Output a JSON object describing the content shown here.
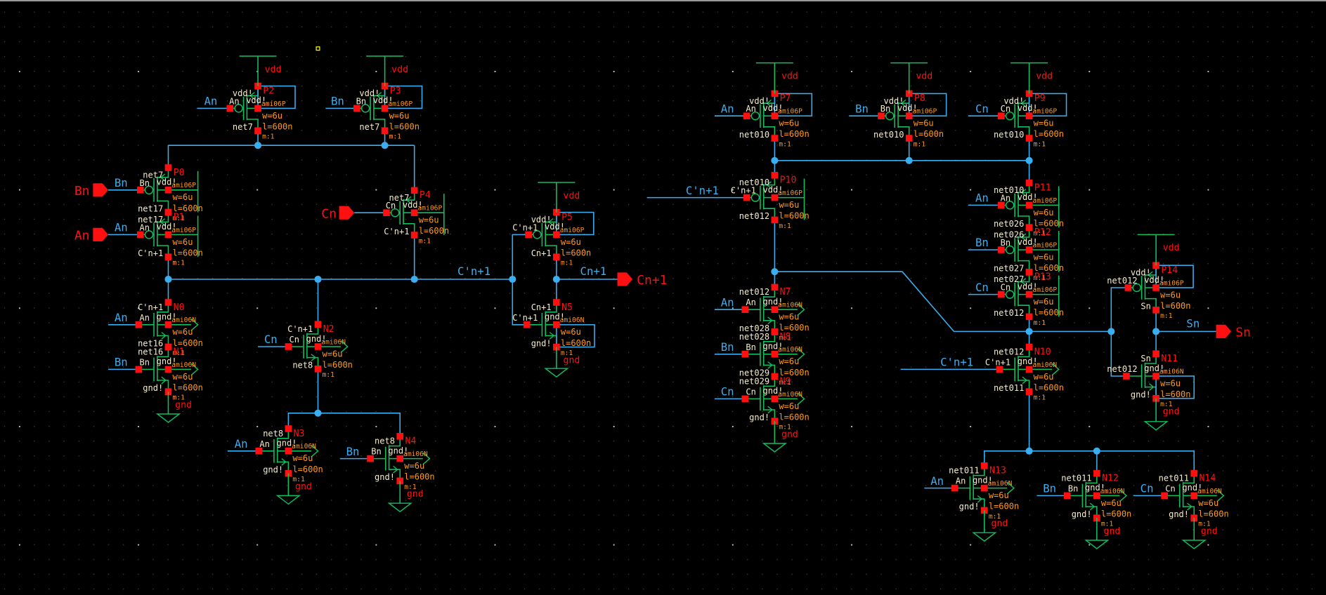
{
  "colors": {
    "background": "#000000",
    "wire": "#3aaef0",
    "device": "#10c060",
    "pin": "#ff1010",
    "net_label": "#f4ecc8",
    "parameter": "#ff9a1a",
    "grid_dot": "#4a4a4a",
    "selection_marker": "#ffff00"
  },
  "supply_labels": {
    "vdd": "vdd",
    "gnd": "gnd"
  },
  "pins": [
    {
      "label": "Bn",
      "direction": "input"
    },
    {
      "label": "An",
      "direction": "input"
    },
    {
      "label": "Cn",
      "direction": "input"
    },
    {
      "label": "Cn+1",
      "direction": "output"
    },
    {
      "label": "Sn",
      "direction": "output"
    }
  ],
  "wire_labels": [
    {
      "text": "C'n+1"
    },
    {
      "text": "Cn+1"
    },
    {
      "text": "Sn"
    }
  ],
  "transistors": [
    {
      "name": "P2",
      "type": "pmos",
      "model": "ami06P",
      "w": "w=6u",
      "l": "l=600n",
      "m": "m:1",
      "gate": "An",
      "top": "vdd!",
      "bottom": "net7",
      "body": "vdd!",
      "input_label": "An"
    },
    {
      "name": "P3",
      "type": "pmos",
      "model": "ami06P",
      "w": "w=6u",
      "l": "l=600n",
      "m": "m:1",
      "gate": "Bn",
      "top": "vdd!",
      "bottom": "net7",
      "body": "vdd!",
      "input_label": "Bn"
    },
    {
      "name": "P0",
      "type": "pmos",
      "model": "ami06P",
      "w": "w=6u",
      "l": "l=600n",
      "m": "m:1",
      "gate": "Bn",
      "top": "net7",
      "bottom": "net17",
      "body": "vdd!",
      "input_label": "Bn"
    },
    {
      "name": "P1",
      "type": "pmos",
      "model": "ami06P",
      "w": "w=6u",
      "l": "l=600n",
      "m": "m:1",
      "gate": "An",
      "top": "net17",
      "bottom": "C'n+1",
      "body": "vdd!",
      "input_label": "An"
    },
    {
      "name": "P4",
      "type": "pmos",
      "model": "ami06P",
      "w": "w=6u",
      "l": "l=600n",
      "m": "m:1",
      "gate": "Cn",
      "top": "net7",
      "bottom": "C'n+1",
      "body": "vdd!",
      "input_label": ""
    },
    {
      "name": "P5",
      "type": "pmos",
      "model": "ami06P",
      "w": "w=6u",
      "l": "l=600n",
      "m": "m:1",
      "gate": "C'n+1",
      "top": "vdd!",
      "bottom": "Cn+1",
      "body": "vdd!",
      "input_label": ""
    },
    {
      "name": "N0",
      "type": "nmos",
      "model": "ami06N",
      "w": "w=6u",
      "l": "l=600n",
      "m": "m:1",
      "gate": "An",
      "top": "C'n+1",
      "bottom": "net16",
      "body": "gnd!",
      "input_label": "An"
    },
    {
      "name": "N1",
      "type": "nmos",
      "model": "ami06N",
      "w": "w=6u",
      "l": "l=600n",
      "m": "m:1",
      "gate": "Bn",
      "top": "net16",
      "bottom": "gnd!",
      "body": "gnd!",
      "input_label": "Bn"
    },
    {
      "name": "N2",
      "type": "nmos",
      "model": "ami06N",
      "w": "w=6u",
      "l": "l=600n",
      "m": "m:1",
      "gate": "Cn",
      "top": "C'n+1",
      "bottom": "net8",
      "body": "gnd!",
      "input_label": "Cn"
    },
    {
      "name": "N3",
      "type": "nmos",
      "model": "ami06N",
      "w": "w=6u",
      "l": "l=600n",
      "m": "m:1",
      "gate": "An",
      "top": "net8",
      "bottom": "gnd!",
      "body": "gnd!",
      "input_label": "An"
    },
    {
      "name": "N4",
      "type": "nmos",
      "model": "ami06N",
      "w": "w=6u",
      "l": "l=600n",
      "m": "m:1",
      "gate": "Bn",
      "top": "net8",
      "bottom": "gnd!",
      "body": "gnd!",
      "input_label": "Bn"
    },
    {
      "name": "N5",
      "type": "nmos",
      "model": "ami06N",
      "w": "w=6u",
      "l": "l=600n",
      "m": "m:1",
      "gate": "C'n+1",
      "top": "Cn+1",
      "bottom": "gnd!",
      "body": "gnd!",
      "input_label": ""
    },
    {
      "name": "P7",
      "type": "pmos",
      "model": "ami06P",
      "w": "w=6u",
      "l": "l=600n",
      "m": "m:1",
      "gate": "An",
      "top": "vdd!",
      "bottom": "net010",
      "body": "vdd!",
      "input_label": "An"
    },
    {
      "name": "P8",
      "type": "pmos",
      "model": "ami06P",
      "w": "w=6u",
      "l": "l=600n",
      "m": "m:1",
      "gate": "Bn",
      "top": "vdd!",
      "bottom": "net010",
      "body": "vdd!",
      "input_label": "Bn"
    },
    {
      "name": "P9",
      "type": "pmos",
      "model": "ami06P",
      "w": "w=6u",
      "l": "l=600n",
      "m": "m:1",
      "gate": "Cn",
      "top": "vdd!",
      "bottom": "net010",
      "body": "vdd!",
      "input_label": "Cn"
    },
    {
      "name": "P10",
      "type": "pmos",
      "model": "ami06P",
      "w": "w=6u",
      "l": "l=600n",
      "m": "m:1",
      "gate": "C'n+1",
      "top": "net010",
      "bottom": "net012",
      "body": "vdd!",
      "input_label": "C'n+1"
    },
    {
      "name": "P11",
      "type": "pmos",
      "model": "ami06P",
      "w": "w=6u",
      "l": "l=600n",
      "m": "m:1",
      "gate": "An",
      "top": "net010",
      "bottom": "net026",
      "body": "vdd!",
      "input_label": "An"
    },
    {
      "name": "P12",
      "type": "pmos",
      "model": "ami06P",
      "w": "w=6u",
      "l": "l=600n",
      "m": "m:1",
      "gate": "Bn",
      "top": "net026",
      "bottom": "net027",
      "body": "vdd!",
      "input_label": "Bn"
    },
    {
      "name": "P13",
      "type": "pmos",
      "model": "ami06P",
      "w": "w=6u",
      "l": "l=600n",
      "m": "m:1",
      "gate": "Cn",
      "top": "net027",
      "bottom": "net012",
      "body": "vdd!",
      "input_label": "Cn"
    },
    {
      "name": "N7",
      "type": "nmos",
      "model": "ami06N",
      "w": "w=6u",
      "l": "l=600n",
      "m": "m:1",
      "gate": "An",
      "top": "net012",
      "bottom": "net028",
      "body": "gnd!",
      "input_label": "An"
    },
    {
      "name": "N8",
      "type": "nmos",
      "model": "ami06N",
      "w": "w=6u",
      "l": "l=600n",
      "m": "m:1",
      "gate": "Bn",
      "top": "net028",
      "bottom": "net029",
      "body": "gnd!",
      "input_label": "Bn"
    },
    {
      "name": "N9",
      "type": "nmos",
      "model": "ami06N",
      "w": "w=6u",
      "l": "l=600n",
      "m": "m:1",
      "gate": "Cn",
      "top": "net029",
      "bottom": "gnd!",
      "body": "gnd!",
      "input_label": "Cn"
    },
    {
      "name": "N10",
      "type": "nmos",
      "model": "ami06N",
      "w": "w=6u",
      "l": "l=600n",
      "m": "m:1",
      "gate": "C'n+1",
      "top": "net012",
      "bottom": "net011",
      "body": "gnd!",
      "input_label": "C'n+1"
    },
    {
      "name": "N13",
      "type": "nmos",
      "model": "ami06N",
      "w": "w=6u",
      "l": "l=600n",
      "m": "m:1",
      "gate": "An",
      "top": "net011",
      "bottom": "gnd!",
      "body": "gnd!",
      "input_label": "An"
    },
    {
      "name": "N12",
      "type": "nmos",
      "model": "ami06N",
      "w": "w=6u",
      "l": "l=600n",
      "m": "m:1",
      "gate": "Bn",
      "top": "net011",
      "bottom": "gnd!",
      "body": "gnd!",
      "input_label": "Bn"
    },
    {
      "name": "N14",
      "type": "nmos",
      "model": "ami06N",
      "w": "w=6u",
      "l": "l=600n",
      "m": "m:1",
      "gate": "Cn",
      "top": "net011",
      "bottom": "gnd!",
      "body": "gnd!",
      "input_label": "Cn"
    },
    {
      "name": "P14",
      "type": "pmos",
      "model": "ami06P",
      "w": "w=6u",
      "l": "l=600n",
      "m": "m:1",
      "gate": "net012",
      "top": "vdd!",
      "bottom": "Sn",
      "body": "vdd!",
      "input_label": ""
    },
    {
      "name": "N11",
      "type": "nmos",
      "model": "ami06N",
      "w": "w=6u",
      "l": "l=600n",
      "m": "m:1",
      "gate": "net012",
      "top": "Sn",
      "bottom": "gnd!",
      "body": "gnd!",
      "input_label": ""
    }
  ]
}
